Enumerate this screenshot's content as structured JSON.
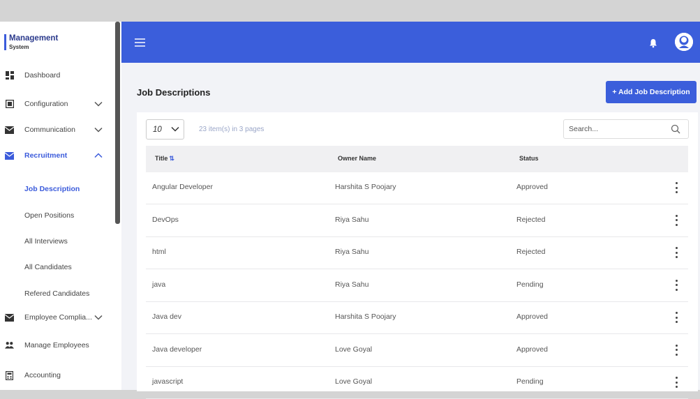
{
  "brand": {
    "title": "Management",
    "subtitle": "System"
  },
  "sidebar": {
    "items": [
      {
        "label": "Dashboard",
        "icon": "dashboard-icon"
      },
      {
        "label": "Configuration",
        "icon": "config-icon"
      },
      {
        "label": "Communication",
        "icon": "mail-icon"
      },
      {
        "label": "Recruitment",
        "icon": "mail-icon"
      },
      {
        "label": "Employee Complia...",
        "icon": "mail-icon"
      },
      {
        "label": "Manage Employees",
        "icon": "people-icon"
      },
      {
        "label": "Accounting",
        "icon": "calculator-icon"
      }
    ],
    "sub_items": [
      {
        "label": "Job Description"
      },
      {
        "label": "Open Positions"
      },
      {
        "label": "All Interviews"
      },
      {
        "label": "All Candidates"
      },
      {
        "label": "Refered Candidates"
      }
    ]
  },
  "header": {
    "menu_icon": "hamburger-icon",
    "bell_icon": "bell-icon",
    "avatar_icon": "user-avatar-icon"
  },
  "page": {
    "title": "Job Descriptions",
    "add_button": "+ Add Job Description"
  },
  "table": {
    "page_size": "10",
    "item_count": "23 item(s) in 3 pages",
    "search_placeholder": "Search...",
    "columns": {
      "title": "Title",
      "owner": "Owner Name",
      "status": "Status"
    },
    "rows": [
      {
        "title": "Angular Developer",
        "owner": "Harshita S Poojary",
        "status": "Approved"
      },
      {
        "title": "DevOps",
        "owner": "Riya Sahu",
        "status": "Rejected"
      },
      {
        "title": "html",
        "owner": "Riya Sahu",
        "status": "Rejected"
      },
      {
        "title": "java",
        "owner": "Riya Sahu",
        "status": "Pending"
      },
      {
        "title": "Java dev",
        "owner": "Harshita S Poojary",
        "status": "Approved"
      },
      {
        "title": "Java developer",
        "owner": "Love Goyal",
        "status": "Approved"
      },
      {
        "title": "javascript",
        "owner": "Love Goyal",
        "status": "Pending"
      }
    ]
  },
  "colors": {
    "primary": "#3b5edb",
    "background": "#f2f3f7",
    "sidebar": "#ffffff"
  }
}
